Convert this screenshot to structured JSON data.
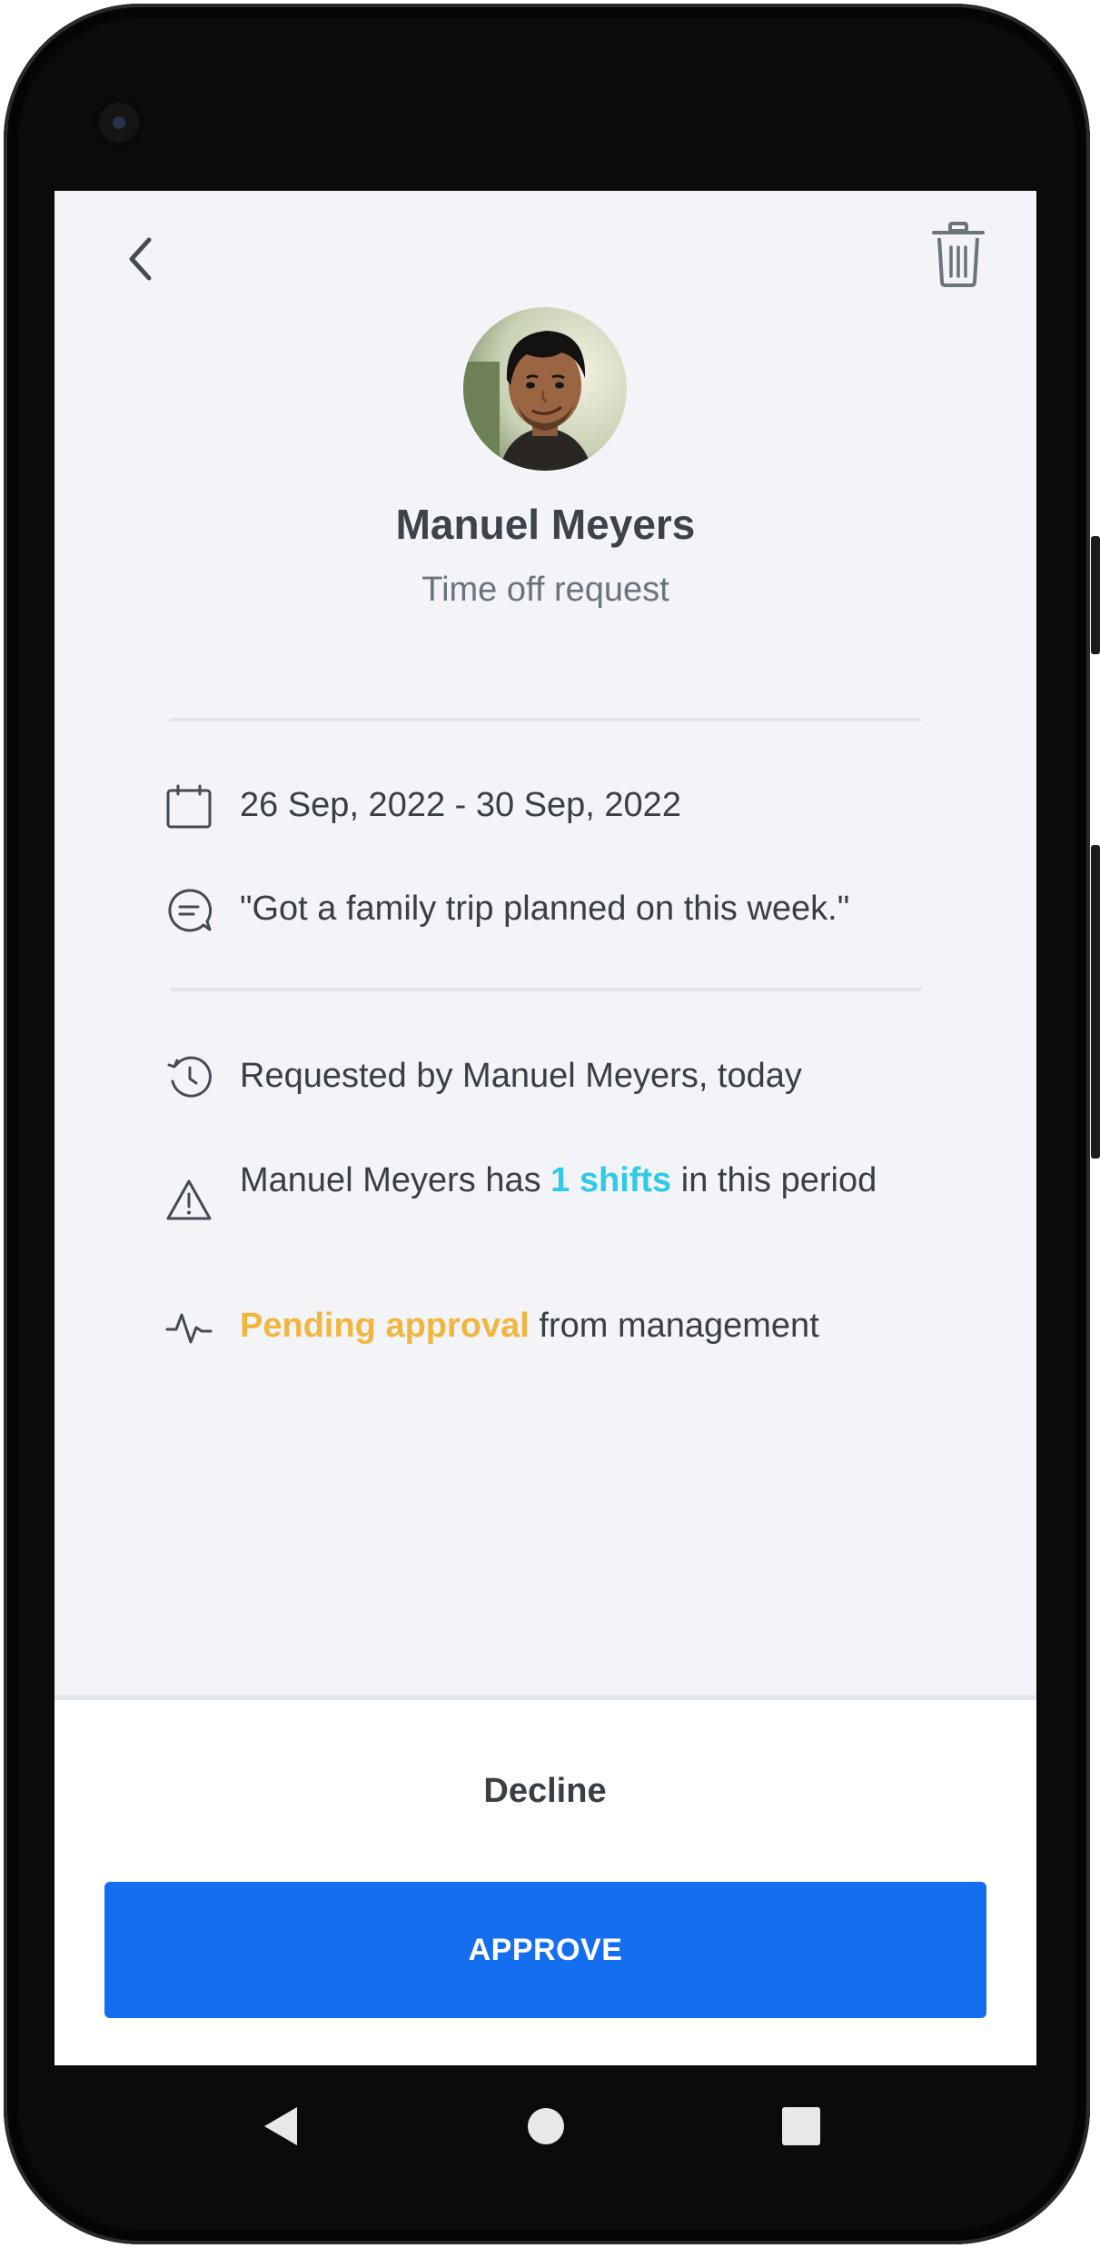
{
  "header": {
    "back_icon": "chevron-left-icon",
    "trash_icon": "trash-icon"
  },
  "profile": {
    "name": "Manuel Meyers",
    "subtitle": "Time off request"
  },
  "details": {
    "date_range": "26 Sep, 2022 - 30 Sep, 2022",
    "note": "\"Got a family trip planned on this week.\"",
    "requested_by": "Requested by Manuel Meyers, today",
    "shifts_prefix": "Manuel Meyers has ",
    "shifts_count": "1 shifts",
    "shifts_suffix": " in this period",
    "status_highlight": "Pending approval",
    "status_suffix": " from management"
  },
  "actions": {
    "decline_label": "Decline",
    "approve_label": "APPROVE"
  },
  "colors": {
    "background": "#f2f4f8",
    "approve_button": "#146eef",
    "shifts_accent": "#2fcbe6",
    "pending_accent": "#f2b640",
    "text": "#3a3f44"
  },
  "system_nav": {
    "back_icon": "nav-back-icon",
    "home_icon": "nav-home-icon",
    "recents_icon": "nav-recents-icon"
  }
}
